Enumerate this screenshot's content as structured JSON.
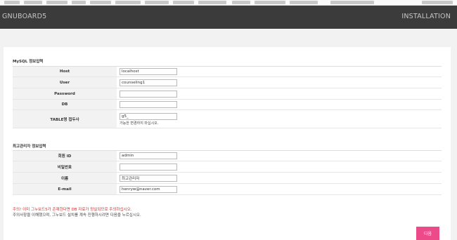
{
  "header": {
    "brand": "GNUBOARD5",
    "right_title": "INSTALLATION"
  },
  "mysql_section": {
    "title": "MySQL 정보입력",
    "rows": [
      {
        "label": "Host",
        "value": "localhost"
      },
      {
        "label": "User",
        "value": "counseling1"
      },
      {
        "label": "Password",
        "value": ""
      },
      {
        "label": "DB",
        "value": ""
      },
      {
        "label": "TABLE명 접두사",
        "value": "g5_",
        "help": "가능한 변경하지 마십시오."
      }
    ]
  },
  "admin_section": {
    "title": "최고관리자 정보입력",
    "rows": [
      {
        "label": "회원 ID",
        "value": "admin"
      },
      {
        "label": "비밀번호",
        "value": ""
      },
      {
        "label": "이름",
        "value": "최고관리자"
      },
      {
        "label": "E-mail",
        "value": "henryw@naver.com"
      }
    ]
  },
  "notice": {
    "warning": "주의! 이미 그누보드5가 존재한다면 DB 자료가 망실되므로 주의하십시오.",
    "info": "주의사항을 이해했으며, 그누보드 설치를 계속 진행하시려면 다음을 누르십시오."
  },
  "next_button": {
    "label": "다음"
  },
  "colors": {
    "header_bg": "#3b3b3b",
    "accent": "#ec4a89",
    "warning": "#c9302c"
  }
}
